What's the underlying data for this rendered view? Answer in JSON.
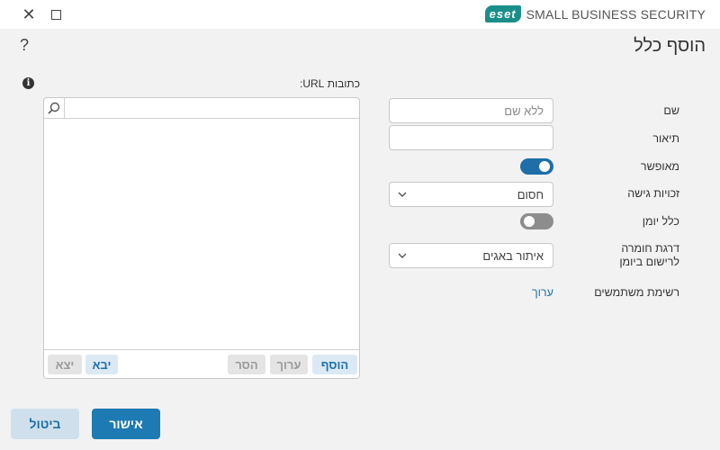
{
  "window": {
    "close_glyph": "✕",
    "brand_logo": "eset",
    "brand_text": "SMALL BUSINESS SECURITY"
  },
  "page": {
    "title": "הוסף כלל",
    "help_glyph": "?"
  },
  "form": {
    "name_label": "שם",
    "name_placeholder": "ללא שם",
    "name_value": "",
    "description_label": "תיאור",
    "description_value": "",
    "enabled_label": "מאופשר",
    "enabled": true,
    "access_label": "זכויות גישה",
    "access_value": "חסום",
    "log_label": "כלל יומן",
    "log_enabled": false,
    "severity_label_line1": "דרגת חומרה",
    "severity_label_line2": "לרישום ביומן",
    "severity_value": "איתור באגים",
    "users_label": "רשימת משתמשים",
    "users_edit": "ערוך"
  },
  "url_panel": {
    "label": "כתובות URL:",
    "search_value": "",
    "items": [],
    "toolbar": {
      "add": "הוסף",
      "edit": "ערוך",
      "remove": "הסר",
      "import": "יבא",
      "export": "יצא"
    }
  },
  "buttons": {
    "ok": "אישור",
    "cancel": "ביטול"
  },
  "colors": {
    "accent": "#1e6fa8",
    "primary_button": "#1e7ab3",
    "brand": "#1a8f8a"
  },
  "icons": {
    "close": "close-icon",
    "maximize": "maximize-icon",
    "help": "help-icon",
    "info": "info-icon",
    "search": "search-icon",
    "chevron": "chevron-down-icon"
  }
}
